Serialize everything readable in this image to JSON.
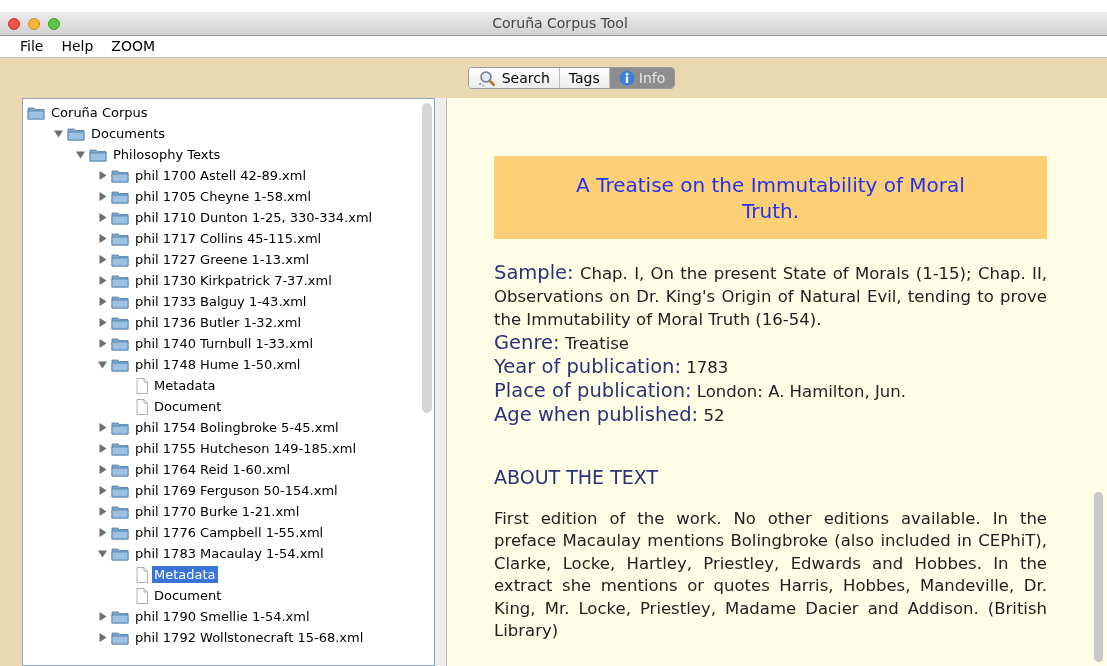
{
  "window": {
    "title": "Coruña Corpus Tool"
  },
  "menu": [
    "File",
    "Help",
    "ZOOM"
  ],
  "tabs": [
    {
      "label": "Search",
      "kind": "search",
      "selected": false
    },
    {
      "label": "Tags",
      "kind": "plain",
      "selected": false
    },
    {
      "label": "Info",
      "kind": "info",
      "selected": true
    }
  ],
  "tree": [
    {
      "label": "Coruña Corpus",
      "kind": "folder",
      "selected": false,
      "children": [
        {
          "label": "Documents",
          "kind": "folder",
          "expanded": true,
          "selected": false,
          "children": [
            {
              "label": "Philosophy Texts",
              "kind": "folder",
              "expanded": true,
              "selected": false,
              "children": [
                {
                  "label": "phil 1700 Astell 42-89.xml",
                  "kind": "folder",
                  "expanded": false,
                  "selected": false
                },
                {
                  "label": "phil 1705 Cheyne 1-58.xml",
                  "kind": "folder",
                  "expanded": false,
                  "selected": false
                },
                {
                  "label": "phil 1710 Dunton 1-25, 330-334.xml",
                  "kind": "folder",
                  "expanded": false,
                  "selected": false
                },
                {
                  "label": "phil 1717 Collins 45-115.xml",
                  "kind": "folder",
                  "expanded": false,
                  "selected": false
                },
                {
                  "label": "phil 1727 Greene 1-13.xml",
                  "kind": "folder",
                  "expanded": false,
                  "selected": false
                },
                {
                  "label": "phil 1730 Kirkpatrick 7-37.xml",
                  "kind": "folder",
                  "expanded": false,
                  "selected": false
                },
                {
                  "label": "phil 1733 Balguy 1-43.xml",
                  "kind": "folder",
                  "expanded": false,
                  "selected": false
                },
                {
                  "label": "phil 1736 Butler 1-32.xml",
                  "kind": "folder",
                  "expanded": false,
                  "selected": false
                },
                {
                  "label": "phil 1740 Turnbull 1-33.xml",
                  "kind": "folder",
                  "expanded": false,
                  "selected": false
                },
                {
                  "label": "phil 1748 Hume 1-50.xml",
                  "kind": "folder",
                  "expanded": true,
                  "selected": false,
                  "children": [
                    {
                      "label": "Metadata",
                      "kind": "file",
                      "selected": false
                    },
                    {
                      "label": "Document",
                      "kind": "file",
                      "selected": false
                    }
                  ]
                },
                {
                  "label": "phil 1754 Bolingbroke 5-45.xml",
                  "kind": "folder",
                  "expanded": false,
                  "selected": false
                },
                {
                  "label": "phil 1755 Hutcheson 149-185.xml",
                  "kind": "folder",
                  "expanded": false,
                  "selected": false
                },
                {
                  "label": "phil 1764 Reid 1-60.xml",
                  "kind": "folder",
                  "expanded": false,
                  "selected": false
                },
                {
                  "label": "phil 1769 Ferguson 50-154.xml",
                  "kind": "folder",
                  "expanded": false,
                  "selected": false
                },
                {
                  "label": "phil 1770 Burke 1-21.xml",
                  "kind": "folder",
                  "expanded": false,
                  "selected": false
                },
                {
                  "label": "phil 1776 Campbell 1-55.xml",
                  "kind": "folder",
                  "expanded": false,
                  "selected": false
                },
                {
                  "label": "phil 1783 Macaulay 1-54.xml",
                  "kind": "folder",
                  "expanded": true,
                  "selected": false,
                  "children": [
                    {
                      "label": "Metadata",
                      "kind": "file",
                      "selected": true
                    },
                    {
                      "label": "Document",
                      "kind": "file",
                      "selected": false
                    }
                  ]
                },
                {
                  "label": "phil 1790 Smellie 1-54.xml",
                  "kind": "folder",
                  "expanded": false,
                  "selected": false
                },
                {
                  "label": "phil 1792 Wollstonecraft 15-68.xml",
                  "kind": "folder",
                  "expanded": false,
                  "selected": false
                }
              ]
            }
          ]
        }
      ]
    }
  ],
  "info": {
    "title": "A Treatise on the Immutability of Moral Truth.",
    "fields": [
      {
        "label": "Sample:",
        "value": "Chap. I, On the present State of Morals (1-15); Chap. II, Observations on Dr. King's Origin of Natural Evil, tending to prove the Immutability of Moral Truth (16-54)."
      },
      {
        "label": "Genre:",
        "value": "Treatise"
      },
      {
        "label": "Year of publication:",
        "value": "1783"
      },
      {
        "label": "Place of publication:",
        "value": "London: A. Hamilton, Jun."
      },
      {
        "label": "Age when published:",
        "value": "52"
      }
    ],
    "section_heading": "ABOUT THE TEXT",
    "paragraph": "First edition of the work. No other editions available. In the preface Macaulay mentions Bolingbroke (also included in CEPhiT), Clarke, Locke, Hartley, Priestley, Edwards and Hobbes. In the extract she mentions or quotes Harris, Hobbes, Mandeville, Dr. King, Mr. Locke, Priestley, Madame Dacier and Addison. (British Library)"
  }
}
